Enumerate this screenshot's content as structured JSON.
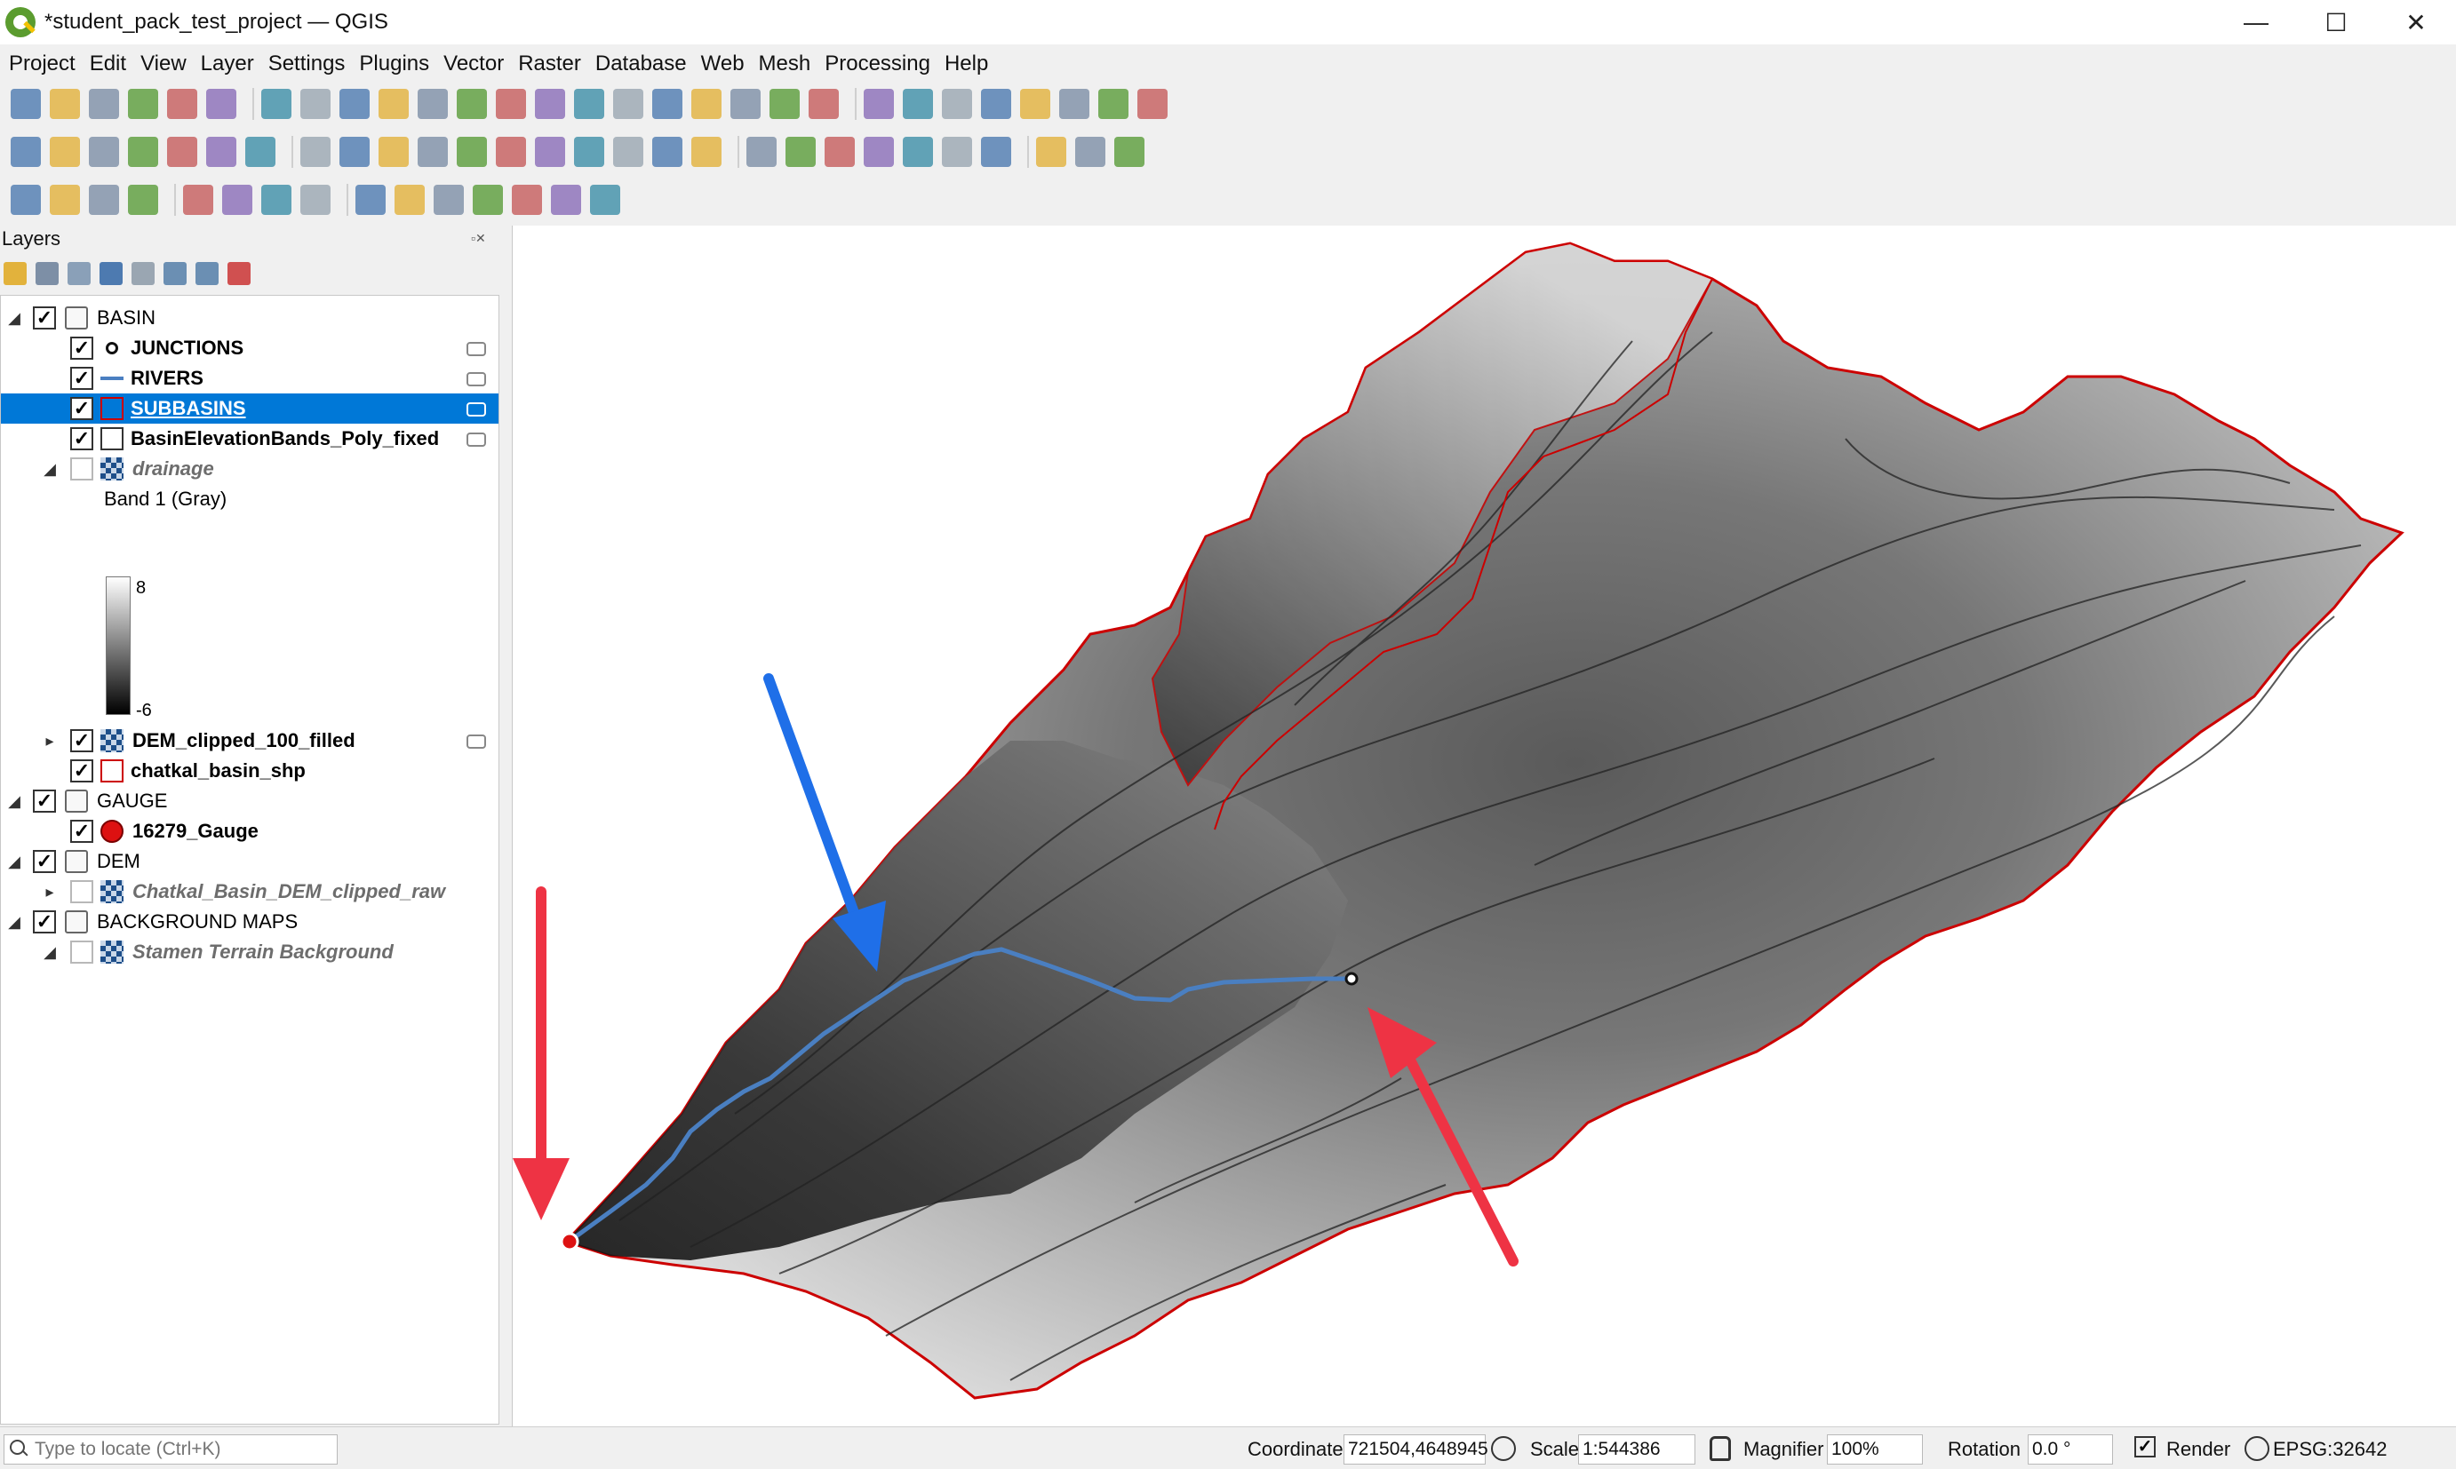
{
  "window": {
    "title": "*student_pack_test_project — QGIS",
    "controls": {
      "minimize": "—",
      "maximize": "☐",
      "close": "✕"
    }
  },
  "menu": [
    "Project",
    "Edit",
    "View",
    "Layer",
    "Settings",
    "Plugins",
    "Vector",
    "Raster",
    "Database",
    "Web",
    "Mesh",
    "Processing",
    "Help"
  ],
  "layers_panel": {
    "title": "Layers",
    "panel_buttons": "▫✕",
    "tree": [
      {
        "label": "BASIN",
        "kind": "group",
        "checked": true,
        "expanded": true
      },
      {
        "label": "JUNCTIONS",
        "kind": "point",
        "checked": true
      },
      {
        "label": "RIVERS",
        "kind": "line",
        "checked": true
      },
      {
        "label": "SUBBASINS",
        "kind": "polygon",
        "checked": true,
        "selected": true
      },
      {
        "label": "BasinElevationBands_Poly_fixed",
        "kind": "polygon-empty",
        "checked": true
      },
      {
        "label": "drainage",
        "kind": "raster",
        "checked": false,
        "expanded": true
      },
      {
        "label": "Band 1 (Gray)",
        "kind": "legend"
      },
      {
        "label": "8",
        "kind": "legend-max"
      },
      {
        "label": "-6",
        "kind": "legend-min"
      },
      {
        "label": "DEM_clipped_100_filled",
        "kind": "raster",
        "checked": true
      },
      {
        "label": "chatkal_basin_shp",
        "kind": "polygon",
        "checked": true
      },
      {
        "label": "GAUGE",
        "kind": "group",
        "checked": true,
        "expanded": true
      },
      {
        "label": "16279_Gauge",
        "kind": "gauge",
        "checked": true
      },
      {
        "label": "DEM",
        "kind": "group",
        "checked": true,
        "expanded": true
      },
      {
        "label": "Chatkal_Basin_DEM_clipped_raw",
        "kind": "raster",
        "checked": false
      },
      {
        "label": "BACKGROUND MAPS",
        "kind": "group",
        "checked": true,
        "expanded": true
      },
      {
        "label": "Stamen Terrain Background",
        "kind": "raster",
        "checked": false
      }
    ]
  },
  "statusbar": {
    "locator_placeholder": "Type to locate (Ctrl+K)",
    "coordinate_label": "Coordinate",
    "coordinate_value": "721504,4648945",
    "scale_label": "Scale",
    "scale_value": "1:544386",
    "magnifier_label": "Magnifier",
    "magnifier_value": "100%",
    "rotation_label": "Rotation",
    "rotation_value": "0.0 °",
    "render_label": "Render",
    "crs": "EPSG:32642"
  },
  "colors": {
    "selection": "#0078d7",
    "basin_outline": "#cc0000",
    "river": "#4a7fc1",
    "arrow_blue": "#1f6fe8",
    "arrow_red": "#ee3344",
    "gauge": "#dd1111"
  },
  "icons": {
    "toolbar1": [
      "new-project-icon",
      "open-project-icon",
      "save-project-icon",
      "save-as-icon",
      "print-layout-icon",
      "style-manager-icon",
      "pan-icon",
      "pan-to-selection-icon",
      "zoom-in-icon",
      "zoom-out-icon",
      "zoom-full-icon",
      "zoom-to-selection-icon",
      "zoom-to-layer-icon",
      "zoom-native-icon",
      "zoom-last-icon",
      "zoom-next-icon",
      "new-map-view-icon",
      "temporal-icon",
      "bookmark-icon",
      "show-bookmarks-icon",
      "refresh-icon",
      "identify-icon",
      "attribute-table-icon",
      "settings-gear-icon",
      "statistics-sum-icon",
      "field-calc-icon",
      "measure-icon",
      "map-tips-icon",
      "annotation-icon"
    ],
    "toolbar2": [
      "data-source-manager-icon",
      "add-vector-icon",
      "add-raster-icon",
      "digitize-icon",
      "layer-order-icon",
      "add-grid-icon",
      "add-wms-icon",
      "edit-pencil-icon",
      "toggle-editing-icon",
      "save-edits-icon",
      "digitize-tools-icon",
      "node-tool-icon",
      "delete-icon",
      "cut-icon",
      "copy-icon",
      "paste-icon",
      "undo-icon",
      "redo-icon",
      "label-abc-icon",
      "label-pin-icon",
      "label-show-icon",
      "label-move-icon",
      "label-rotate-icon",
      "label-change-icon",
      "label-tools-icon",
      "globe-icon",
      "python-icon",
      "help-icon"
    ],
    "toolbar3": [
      "select-features-icon",
      "select-by-value-icon",
      "deselect-icon",
      "add-to-selection-icon",
      "edit-attr-icon",
      "merge-icon",
      "split-icon",
      "reshape-icon",
      "text-annotation-icon",
      "select-tool-icon",
      "select-polygon-icon",
      "select-freehand-icon",
      "star-icon",
      "add-text-icon",
      "text-tool-icon"
    ]
  }
}
